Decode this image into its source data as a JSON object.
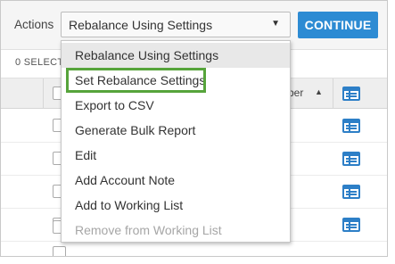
{
  "actions_bar": {
    "label": "Actions",
    "select_value": "Rebalance Using Settings",
    "continue_label": "CONTINUE"
  },
  "status": {
    "selected_count": "0 SELECT"
  },
  "table": {
    "sort_column_label": "ber",
    "sort_direction": "ascending",
    "visible_rows": 7
  },
  "menu": {
    "items": [
      {
        "label": "Rebalance Using Settings",
        "state": "hover"
      },
      {
        "label": "Set Rebalance Settings",
        "state": "highlighted"
      },
      {
        "label": "Export to CSV",
        "state": "normal"
      },
      {
        "label": "Generate Bulk Report",
        "state": "normal"
      },
      {
        "label": "Edit",
        "state": "normal"
      },
      {
        "label": "Add Account Note",
        "state": "normal"
      },
      {
        "label": "Add to Working List",
        "state": "normal"
      },
      {
        "label": "Remove from Working List",
        "state": "disabled"
      }
    ]
  },
  "colors": {
    "accent_blue": "#2d8bd3",
    "highlight_green": "#56a43b",
    "disabled_text": "#a6a6a6"
  }
}
